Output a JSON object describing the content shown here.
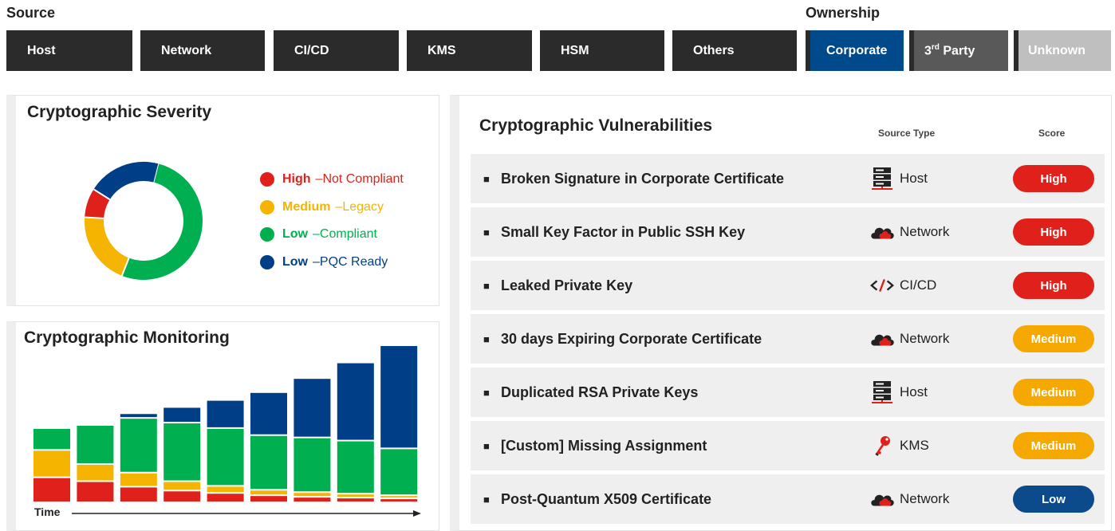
{
  "source": {
    "label": "Source",
    "buttons": [
      {
        "label": "Host",
        "color": "#2b2b2b"
      },
      {
        "label": "Network",
        "color": "#2b2b2b"
      },
      {
        "label": "CI/CD",
        "color": "#2b2b2b"
      },
      {
        "label": "KMS",
        "color": "#2b2b2b"
      },
      {
        "label": "HSM",
        "color": "#2b2b2b"
      },
      {
        "label": "Others",
        "color": "#2b2b2b"
      }
    ]
  },
  "ownership": {
    "label": "Ownership",
    "buttons": [
      {
        "label": "Corporate",
        "color": "#004a8c"
      },
      {
        "label_main": "3",
        "label_sup": "rd",
        "label_rest": " Party",
        "color": "#595959"
      },
      {
        "label": "Unknown",
        "color": "#bfbfbf"
      }
    ]
  },
  "severity": {
    "title": "Cryptographic Severity",
    "slices": [
      {
        "value": 52,
        "color": "#00b050"
      },
      {
        "value": 20,
        "color": "#f5b400"
      },
      {
        "value": 8,
        "color": "#e0201b"
      },
      {
        "value": 20,
        "color": "#003f87"
      }
    ],
    "legend": [
      {
        "bold": "High",
        "sep": " – ",
        "rest": "Not Compliant",
        "color": "#e0201b"
      },
      {
        "bold": "Medium",
        "sep": "  – ",
        "rest": "Legacy",
        "color": "#f5b400"
      },
      {
        "bold": "Low",
        "sep": " – ",
        "rest": "Compliant",
        "color": "#00b050"
      },
      {
        "bold": "Low",
        "sep": " – ",
        "rest": "PQC Ready",
        "color": "#003f87"
      }
    ]
  },
  "monitoring": {
    "title": "Cryptographic Monitoring",
    "time_label": "Time",
    "chart_data": {
      "type": "bar",
      "stacked": true,
      "series": [
        {
          "color": "#e0201b",
          "values": [
            32,
            27,
            20,
            15,
            12,
            9,
            7,
            6,
            5
          ]
        },
        {
          "color": "#f5b400",
          "values": [
            35,
            22,
            18,
            12,
            9,
            7,
            6,
            5,
            4
          ]
        },
        {
          "color": "#00b050",
          "values": [
            28,
            50,
            70,
            75,
            74,
            70,
            70,
            68,
            60
          ]
        },
        {
          "color": "#003f87",
          "values": [
            0,
            0,
            6,
            20,
            36,
            55,
            76,
            100,
            132
          ]
        }
      ],
      "categories": [
        "",
        "",
        "",
        "",
        "",
        "",
        "",
        "",
        ""
      ]
    }
  },
  "vulnerabilities": {
    "title": "Cryptographic Vulnerabilities",
    "col_source": "Source Type",
    "col_score": "Score",
    "rows": [
      {
        "title": "Broken Signature in Corporate Certificate",
        "source": "Host",
        "icon": "server-icon",
        "score": "High",
        "score_color": "#e0201b"
      },
      {
        "title": "Small Key Factor in Public SSH Key",
        "source": "Network",
        "icon": "cloud-icon",
        "score": "High",
        "score_color": "#e0201b"
      },
      {
        "title": "Leaked Private Key",
        "source": "CI/CD",
        "icon": "code-icon",
        "score": "High",
        "score_color": "#e0201b"
      },
      {
        "title": "30 days Expiring Corporate Certificate",
        "source": "Network",
        "icon": "cloud-icon",
        "score": "Medium",
        "score_color": "#f5a800"
      },
      {
        "title": "Duplicated RSA Private Keys",
        "source": "Host",
        "icon": "server-icon",
        "score": "Medium",
        "score_color": "#f5a800"
      },
      {
        "title": "[Custom]  Missing Assignment",
        "source": "KMS",
        "icon": "key-icon",
        "score": "Medium",
        "score_color": "#f5a800"
      },
      {
        "title": "Post-Quantum X509 Certificate",
        "source": "Network",
        "icon": "cloud-icon",
        "score": "Low",
        "score_color": "#0b4a8b"
      }
    ]
  }
}
